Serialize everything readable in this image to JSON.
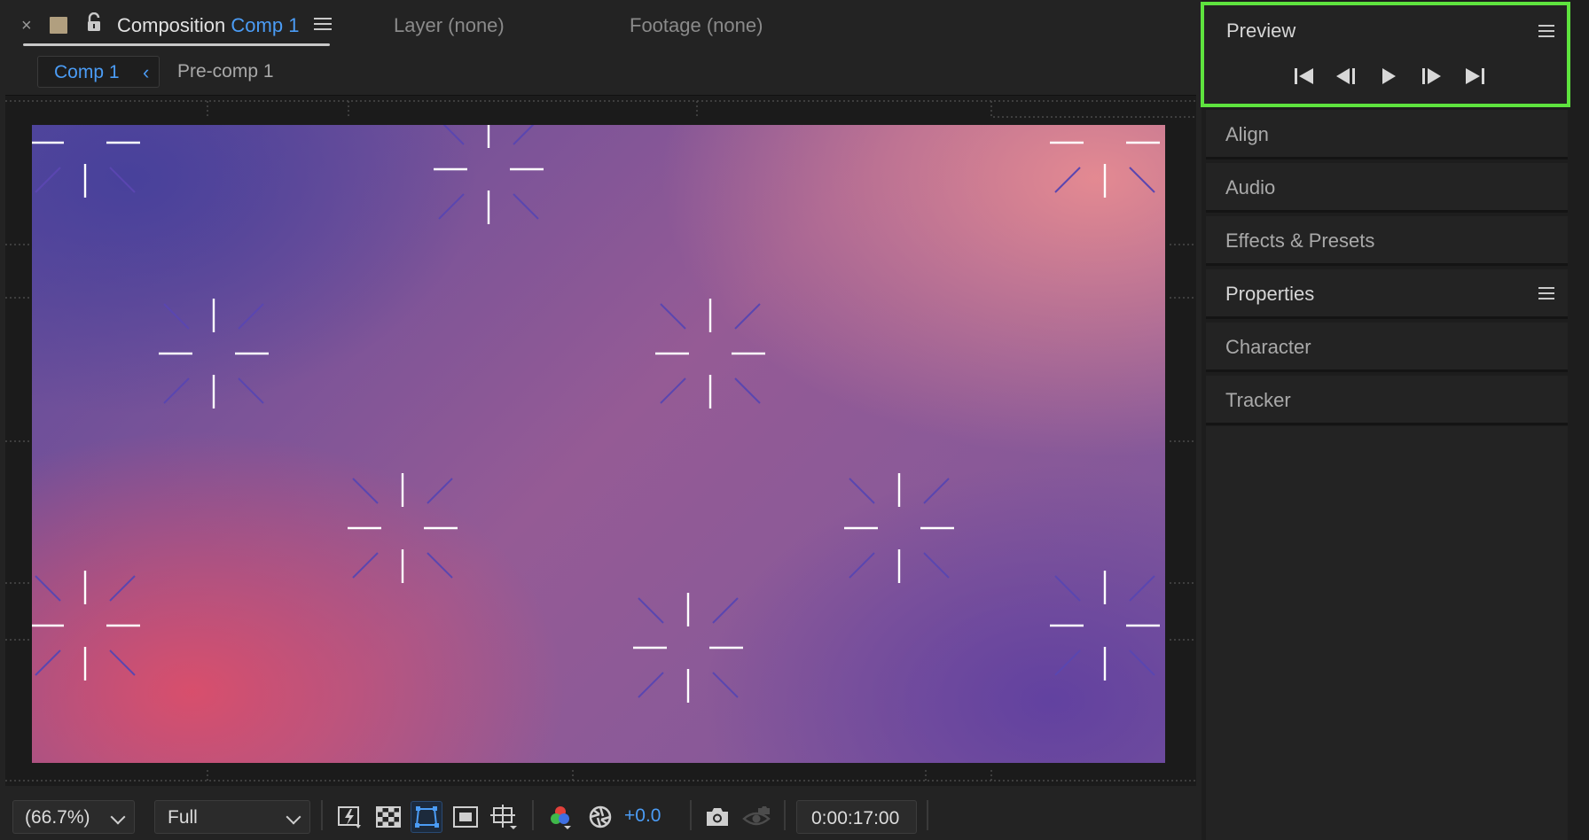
{
  "tabs": {
    "composition_label": "Composition",
    "composition_name": "Comp 1",
    "layer": "Layer (none)",
    "footage": "Footage (none)",
    "close": "×"
  },
  "breadcrumb": {
    "active": "Comp 1",
    "active_chevron": "‹",
    "next": "Pre-comp 1"
  },
  "toolbar": {
    "zoom": "(66.7%)",
    "resolution": "Full",
    "exposure": "+0.0",
    "timecode": "0:00:17:00"
  },
  "preview": {
    "title": "Preview",
    "buttons": [
      "first-frame",
      "previous-frame",
      "play",
      "next-frame",
      "last-frame"
    ]
  },
  "dock_panels": [
    {
      "label": "Align"
    },
    {
      "label": "Audio"
    },
    {
      "label": "Effects & Presets"
    },
    {
      "label": "Properties"
    },
    {
      "label": "Character"
    },
    {
      "label": "Tracker"
    }
  ],
  "colors": {
    "accent_blue": "#4b9cf5",
    "highlight_green": "#5ee33e",
    "panel_bg": "#232323"
  }
}
